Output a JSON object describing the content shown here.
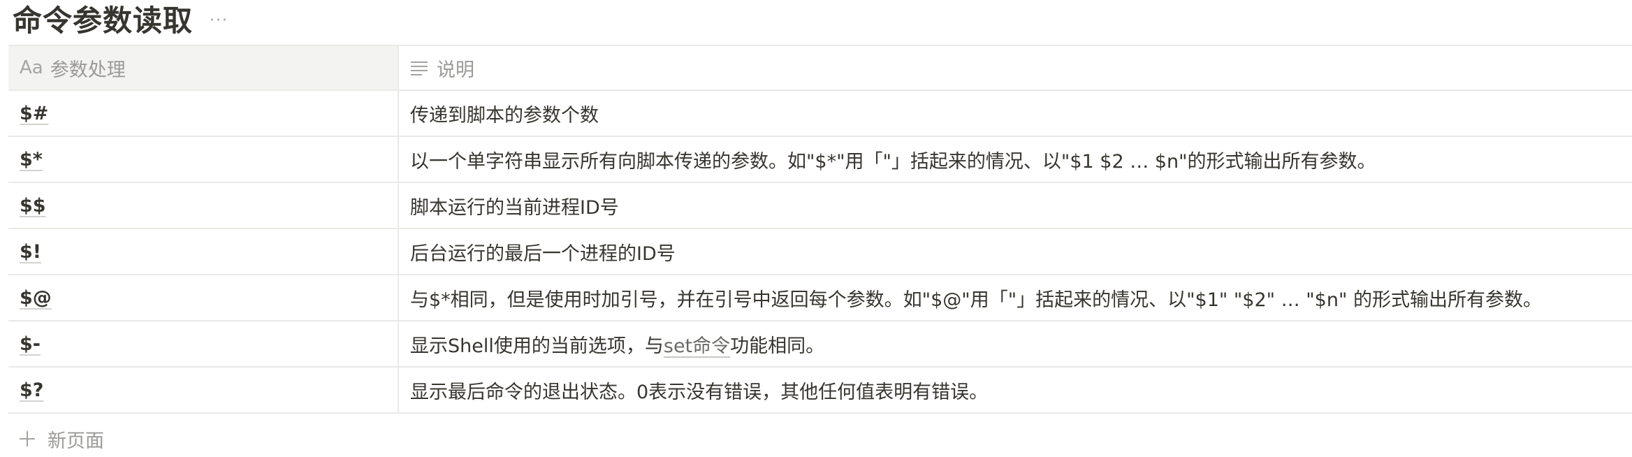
{
  "database": {
    "title": "命令参数读取",
    "more_label": "···"
  },
  "table": {
    "columns": [
      {
        "icon": "title-property-icon",
        "icon_text": "Aa",
        "label": "参数处理"
      },
      {
        "icon": "text-property-icon",
        "label": "说明"
      }
    ],
    "rows": [
      {
        "key": "$#",
        "desc": "传递到脚本的参数个数"
      },
      {
        "key": "$*",
        "desc": "以一个单字符串显示所有向脚本传递的参数。如\"$*\"用「\"」括起来的情况、以\"$1 $2 … $n\"的形式输出所有参数。"
      },
      {
        "key": "$$",
        "desc": "脚本运行的当前进程ID号"
      },
      {
        "key": "$!",
        "desc": "后台运行的最后一个进程的ID号"
      },
      {
        "key": "$@",
        "desc": "与$*相同，但是使用时加引号，并在引号中返回每个参数。如\"$@\"用「\"」括起来的情况、以\"$1\" \"$2\" … \"$n\" 的形式输出所有参数。"
      },
      {
        "key": "$-",
        "desc_before": "显示Shell使用的当前选项，与",
        "desc_link": "set命令",
        "desc_after": "功能相同。"
      },
      {
        "key": "$?",
        "desc": "显示最后命令的退出状态。0表示没有错误，其他任何值表明有错误。"
      }
    ]
  },
  "new_page": {
    "label": "新页面"
  }
}
